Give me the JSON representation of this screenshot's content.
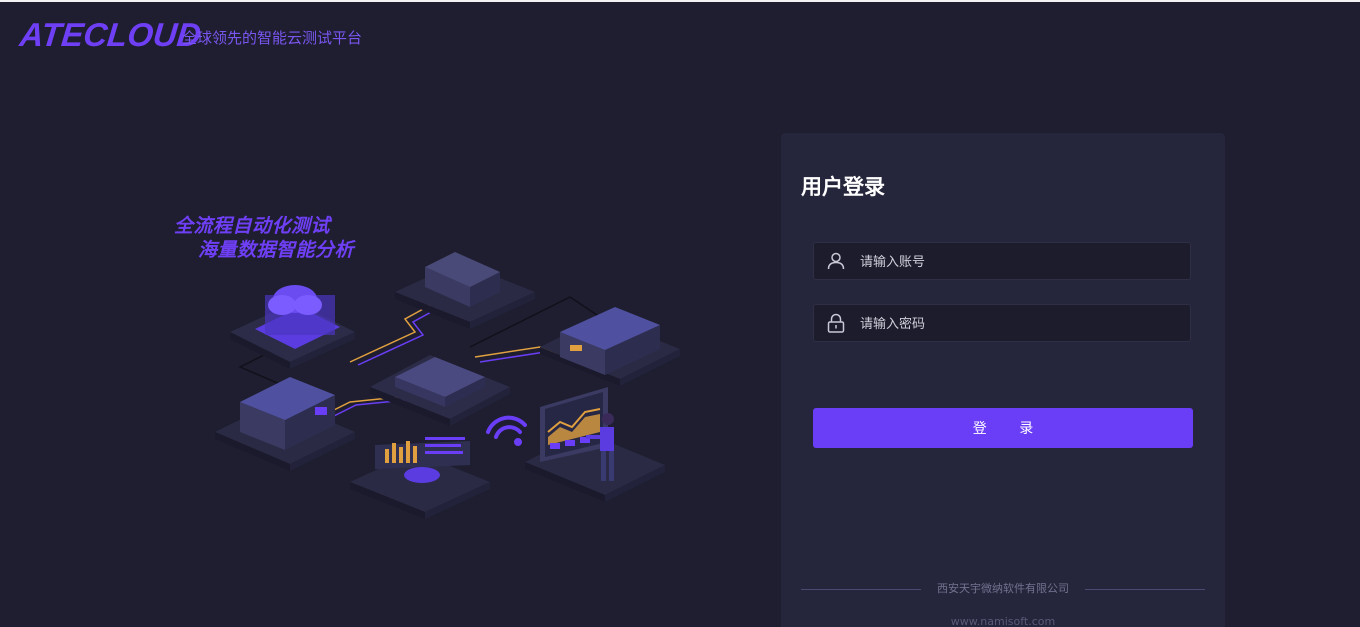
{
  "header": {
    "logo_text": "ATECLOUD",
    "tagline": "全球领先的智能云测试平台"
  },
  "hero": {
    "slogan_line1": "全流程自动化测试",
    "slogan_line2": "海量数据智能分析"
  },
  "login": {
    "title": "用户登录",
    "username_placeholder": "请输入账号",
    "password_placeholder": "请输入密码",
    "username_value": "",
    "password_value": "",
    "submit_label": "登 录",
    "company": "西安天宇微纳软件有限公司",
    "website": "www.namisoft.com"
  },
  "colors": {
    "background": "#1e1e30",
    "panel": "#25253b",
    "accent": "#6a3ef6",
    "input_bg": "#1c1c2c"
  },
  "icons": {
    "username": "user-icon",
    "password": "lock-icon"
  }
}
